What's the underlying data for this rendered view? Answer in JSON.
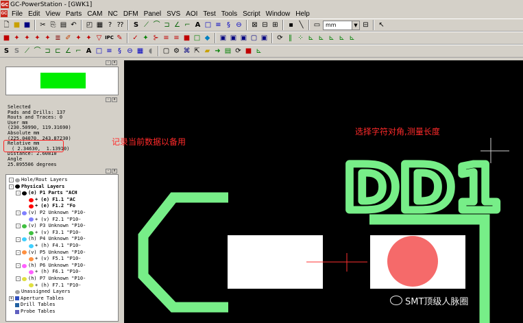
{
  "window": {
    "title": "GC-PowerStation - [GWK1]",
    "logo": "GC"
  },
  "menu": [
    "File",
    "Edit",
    "View",
    "Parts",
    "CAM",
    "NC",
    "DFM",
    "Panel",
    "SVS",
    "AOI",
    "Test",
    "Tools",
    "Script",
    "Window",
    "Help"
  ],
  "toolbar": {
    "units": "mm"
  },
  "info": {
    "lines": [
      "Selected",
      "Pads and Drills: 137",
      "Routs and Traces: 0",
      "User mm",
      "(230.50990, 119.31690)",
      "Absolute mm",
      "(225.04070, 243.87230)"
    ],
    "relative_label": "Relative mm",
    "relative_value": "( 2.34630,  1.13910)",
    "distance": "Distance: 2.60810",
    "angle_label": "Angle",
    "angle_value": "25.895506 degrees"
  },
  "tree": [
    {
      "label": "Hole/Rout Layers",
      "level": 0,
      "tog": "-",
      "mark": "gray"
    },
    {
      "label": "Physical Layers",
      "level": 0,
      "tog": "-",
      "mark": "black",
      "bold": true
    },
    {
      "label": "(e) P1 Parts \"ACH",
      "level": 1,
      "tog": "-",
      "mark": "black",
      "bold": true
    },
    {
      "label": "+ (e) F1.1 \"AC",
      "level": 2,
      "mark": "red",
      "bold": true
    },
    {
      "label": "+ (e) F1.2 \"Fo",
      "level": 2,
      "mark": "red",
      "bold": true
    },
    {
      "label": "(v) P2 Unknown \"P10-",
      "level": 1,
      "tog": "-",
      "mark": "#8080ff"
    },
    {
      "label": "+ (v) F2.1 \"P10-",
      "level": 2,
      "mark": "#8080ff"
    },
    {
      "label": "(v) P3 Unknown \"P10-",
      "level": 1,
      "tog": "-",
      "mark": "#40c040"
    },
    {
      "label": "+ (v) F3.1 \"P10-",
      "level": 2,
      "mark": "#40c040"
    },
    {
      "label": "(h) P4 Unknown \"P10-",
      "level": 1,
      "tog": "-",
      "mark": "#40d0ff"
    },
    {
      "label": "+ (h) F4.1 \"P10-",
      "level": 2,
      "mark": "#40d0ff"
    },
    {
      "label": "(v) P5 Unknown \"P10-",
      "level": 1,
      "tog": "-",
      "mark": "#ff9040"
    },
    {
      "label": "+ (v) F5.1 \"P10-",
      "level": 2,
      "mark": "#ff9040"
    },
    {
      "label": "(h) P6 Unknown \"P10-",
      "level": 1,
      "tog": "-",
      "mark": "#ff60ff"
    },
    {
      "label": "+ (h) F6.1 \"P10-",
      "level": 2,
      "mark": "#ff60ff"
    },
    {
      "label": "(h) P7 Unknown \"P10-",
      "level": 1,
      "tog": "-",
      "mark": "#e0e040"
    },
    {
      "label": "+ (h) F7.1 \"P10-",
      "level": 2,
      "mark": "#e0e040"
    },
    {
      "label": "Unassigned Layers",
      "level": 0,
      "mark": "gray"
    },
    {
      "label": "Aperture Tables",
      "level": 0,
      "tog": "+",
      "mark": "ap"
    },
    {
      "label": "Drill Tables",
      "level": 0,
      "mark": "dr"
    },
    {
      "label": "Probe Tables",
      "level": 0,
      "mark": "pr"
    }
  ],
  "canvas": {
    "refdes": "DD1",
    "annotation_left": "记录当前数据以备用",
    "annotation_right": "选择字符对角,测量长度",
    "watermark": "SMT顶级人脉圈",
    "colors": {
      "silk": "#77ee88",
      "pad": "#ffffff",
      "drill": "#f56a6a",
      "crosshair": "#ff3030",
      "annotation": "#ff2a2a",
      "preview": "#00ee00"
    }
  }
}
